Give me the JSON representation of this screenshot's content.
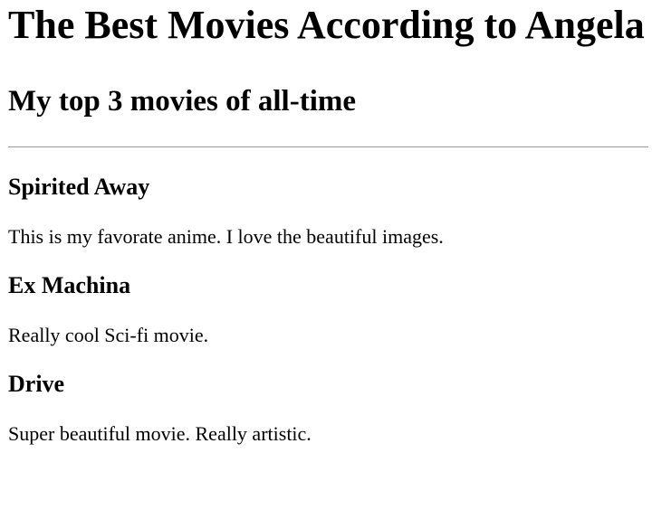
{
  "page": {
    "title": "The Best Movies According to Angela",
    "subtitle": "My top 3 movies of all-time"
  },
  "movies": [
    {
      "title": "Spirited Away",
      "description": "This is my favorate anime. I love the beautiful images."
    },
    {
      "title": "Ex Machina",
      "description": "Really cool Sci-fi movie."
    },
    {
      "title": "Drive",
      "description": "Super beautiful movie. Really artistic."
    }
  ]
}
